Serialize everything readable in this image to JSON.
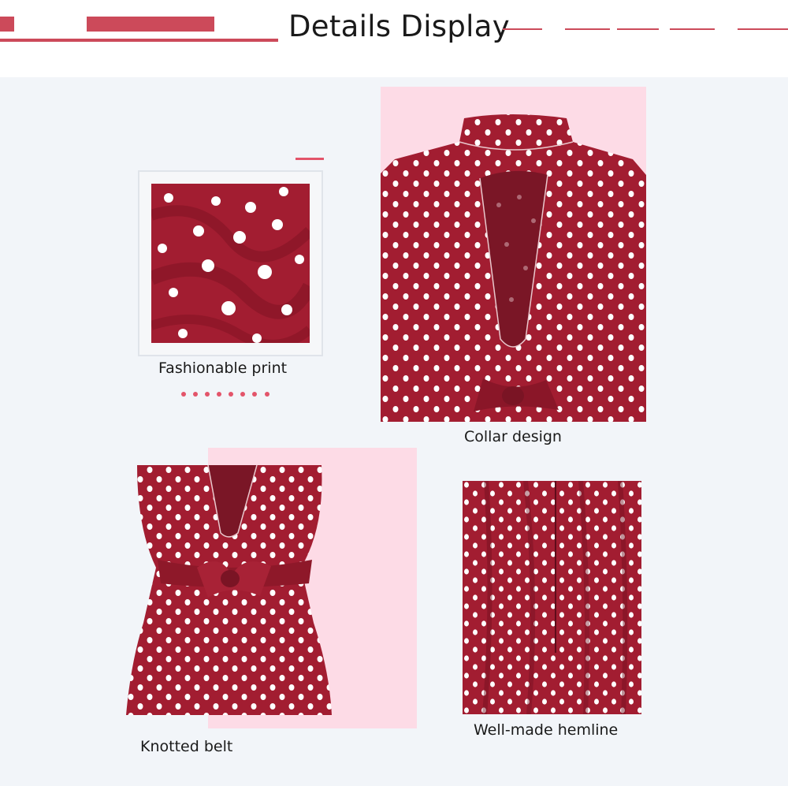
{
  "header": {
    "title": "Details Display"
  },
  "captions": {
    "print": "Fashionable print",
    "collar": "Collar design",
    "belt": "Knotted belt",
    "hemline": "Well-made hemline"
  },
  "colors": {
    "accent_bar": "#cc4a5a",
    "accent_pink": "#e3546a",
    "soft_pink": "#fddbe6",
    "background": "#f2f5f9",
    "fabric": "#9f1b2f"
  }
}
